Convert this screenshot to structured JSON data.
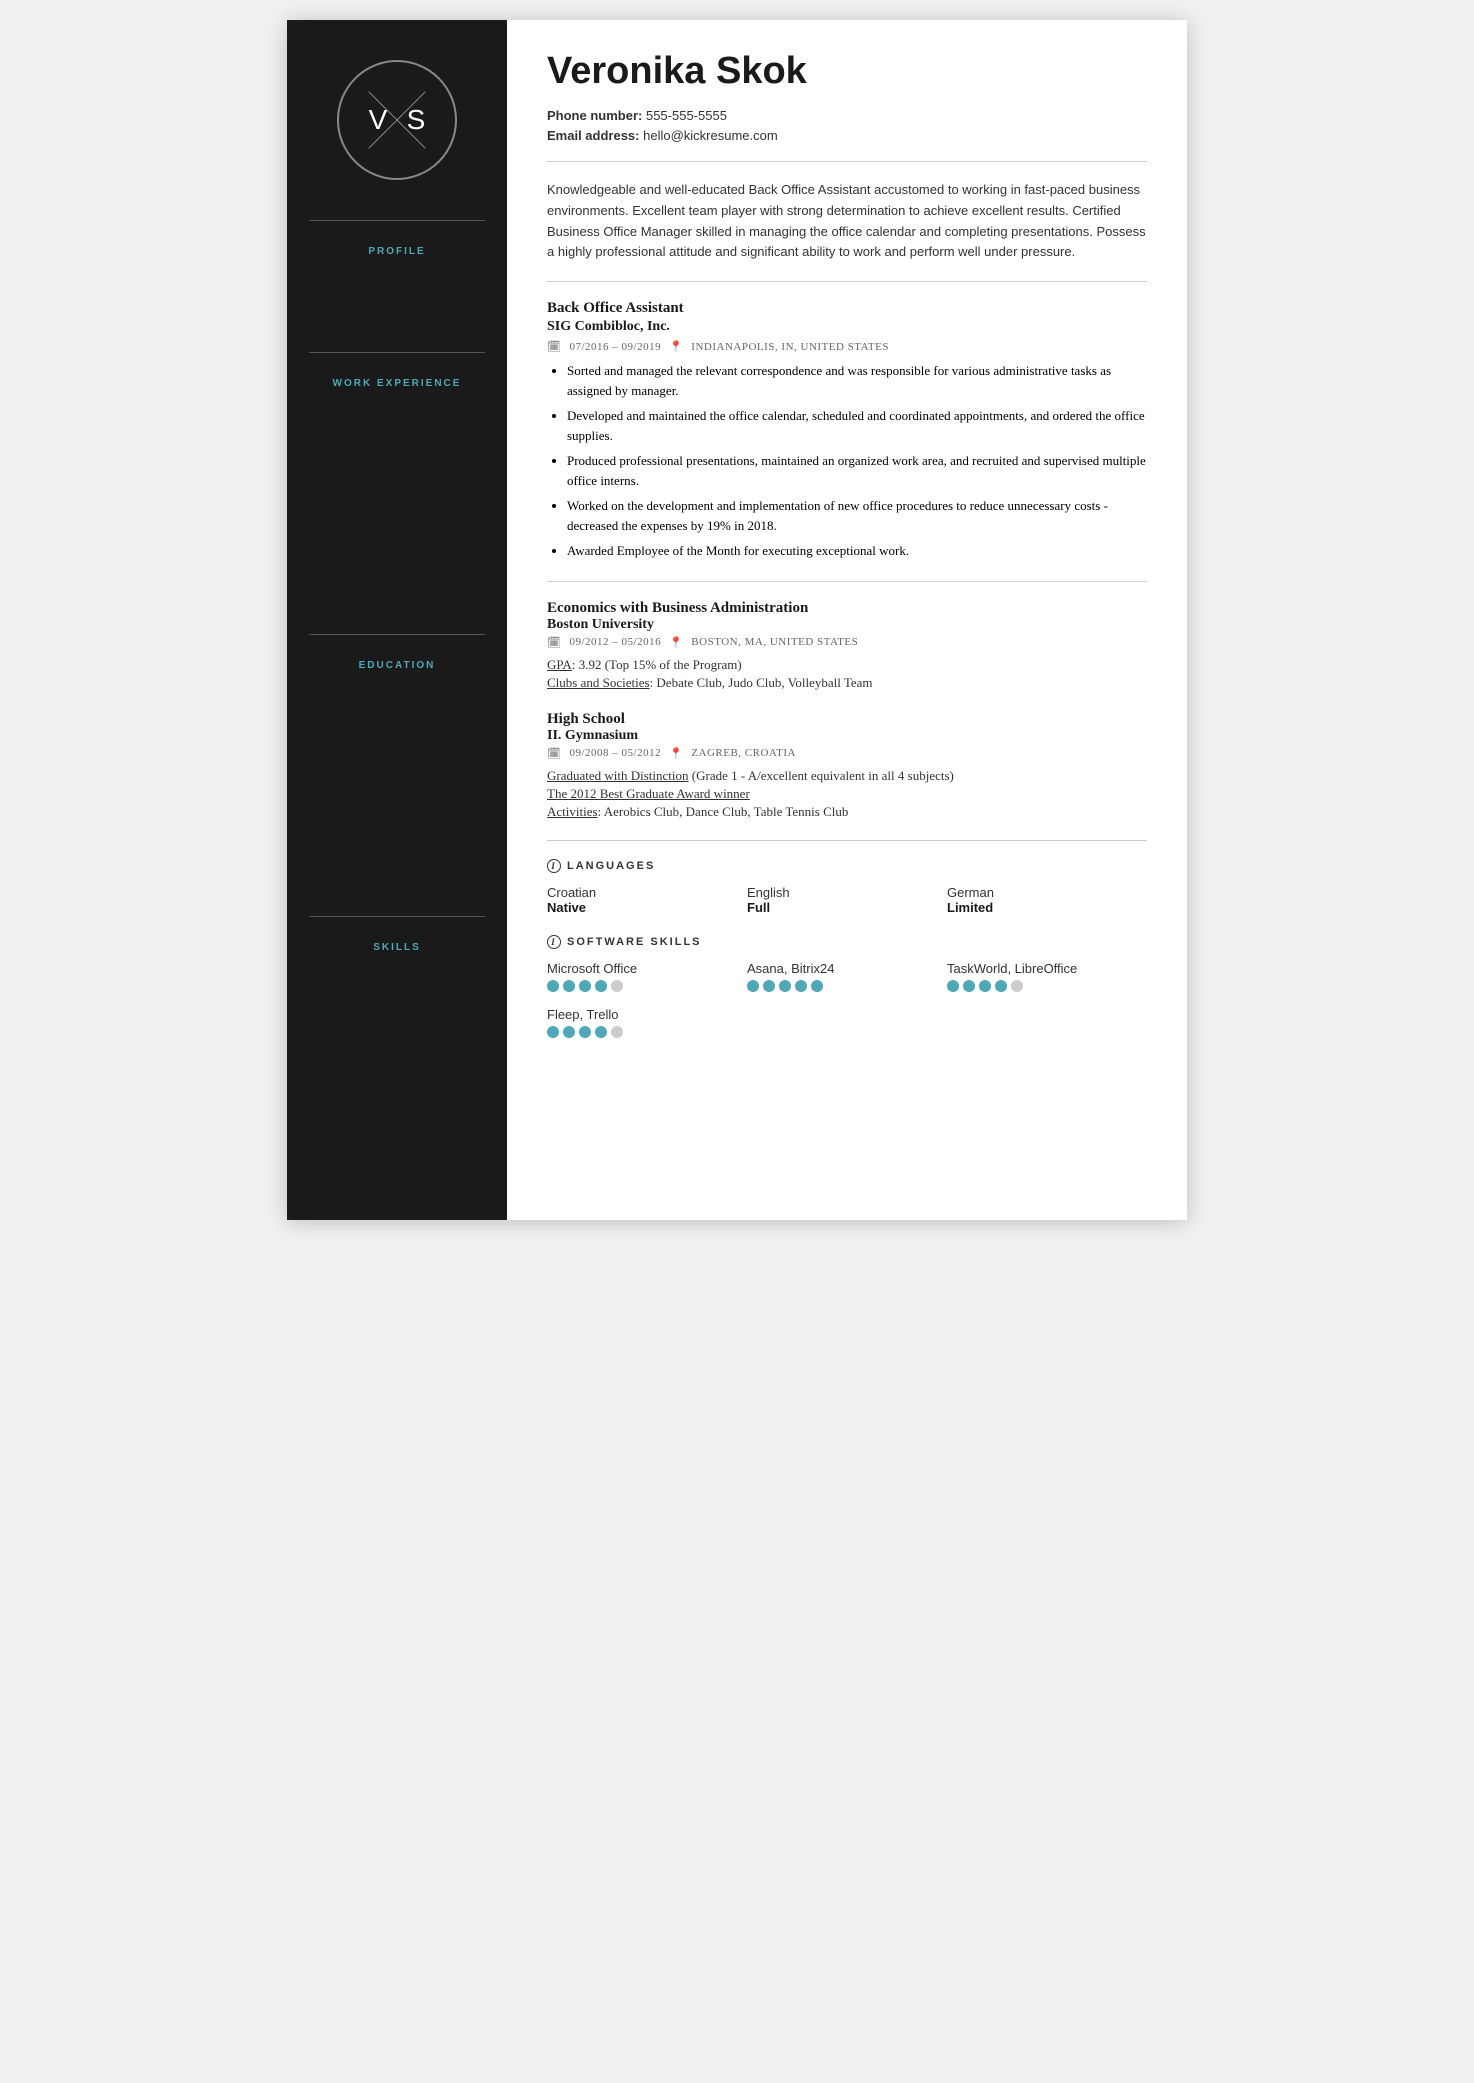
{
  "sidebar": {
    "initials": {
      "first": "V",
      "last": "S"
    },
    "sections": [
      {
        "label": "Profile",
        "id": "profile"
      },
      {
        "label": "Work Experience",
        "id": "work-experience"
      },
      {
        "label": "Education",
        "id": "education"
      },
      {
        "label": "Skills",
        "id": "skills"
      }
    ]
  },
  "header": {
    "name": "Veronika Skok",
    "phone_label": "Phone number:",
    "phone": "555-555-5555",
    "email_label": "Email address:",
    "email": "hello@kickresume.com"
  },
  "profile": {
    "text": "Knowledgeable and well-educated Back Office Assistant accustomed to working in fast-paced business environments. Excellent team player with strong determination to achieve excellent results. Certified Business Office Manager skilled in managing the office calendar and completing presentations. Possess a highly professional attitude and significant ability to work and perform well under pressure."
  },
  "work_experience": {
    "jobs": [
      {
        "title": "Back Office Assistant",
        "company": "SIG Combibloc, Inc.",
        "period": "07/2016 – 09/2019",
        "location": "INDIANAPOLIS, IN, UNITED STATES",
        "bullets": [
          "Sorted and managed the relevant correspondence and was responsible for various administrative tasks as assigned by manager.",
          "Developed and maintained the office calendar, scheduled and coordinated appointments, and ordered the office supplies.",
          "Produced professional presentations, maintained an organized work area, and recruited and supervised multiple office interns.",
          "Worked on the development and implementation of new office procedures to reduce unnecessary costs - decreased the expenses by 19% in 2018.",
          "Awarded Employee of the Month for executing exceptional work."
        ]
      }
    ]
  },
  "education": {
    "entries": [
      {
        "degree": "Economics with Business Administration",
        "school": "Boston University",
        "period": "09/2012 – 05/2016",
        "location": "BOSTON, MA, UNITED STATES",
        "gpa_label": "GPA",
        "gpa": "3.92 (Top 15% of the Program)",
        "clubs_label": "Clubs and Societies",
        "clubs": "Debate Club, Judo Club, Volleyball Team"
      },
      {
        "degree": "High School",
        "school": "II. Gymnasium",
        "period": "09/2008 – 05/2012",
        "location": "ZAGREB, CROATIA",
        "distinction_label": "Graduated with Distinction",
        "distinction": " (Grade 1 - A/excellent equivalent in all 4 subjects)",
        "award": "The 2012 Best Graduate Award winner",
        "activities_label": "Activities",
        "activities": "Aerobics Club, Dance Club, Table Tennis Club"
      }
    ]
  },
  "skills": {
    "languages_label": "LANGUAGES",
    "software_label": "SOFTWARE SKILLS",
    "languages": [
      {
        "name": "Croatian",
        "level": "Native",
        "dots": [
          1,
          1,
          1,
          1,
          1
        ]
      },
      {
        "name": "English",
        "level": "Full",
        "dots": [
          1,
          1,
          1,
          1,
          1
        ]
      },
      {
        "name": "German",
        "level": "Limited",
        "dots": [
          1,
          1,
          0,
          0,
          0
        ]
      }
    ],
    "software": [
      {
        "name": "Microsoft Office",
        "dots": [
          1,
          1,
          1,
          1,
          0
        ]
      },
      {
        "name": "Asana, Bitrix24",
        "dots": [
          1,
          1,
          1,
          1,
          1
        ]
      },
      {
        "name": "TaskWorld, LibreOffice",
        "dots": [
          1,
          1,
          1,
          1,
          0
        ]
      },
      {
        "name": "Fleep, Trello",
        "dots": [
          1,
          1,
          1,
          1,
          0
        ]
      }
    ]
  }
}
